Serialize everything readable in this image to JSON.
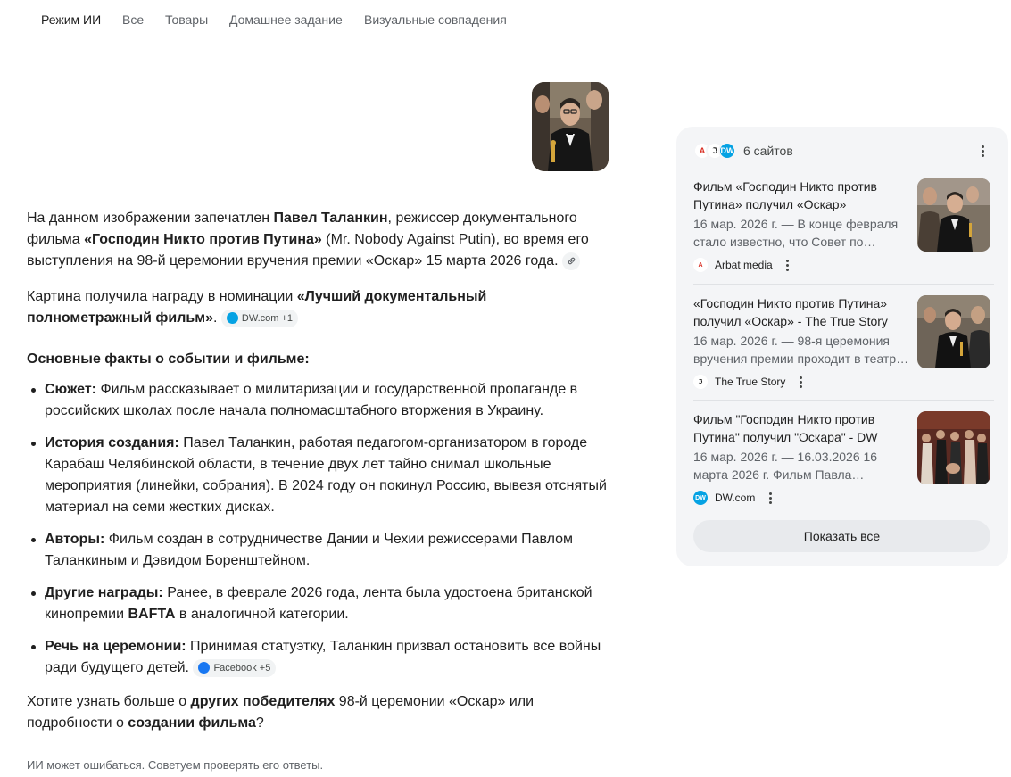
{
  "tabs": [
    {
      "label": "Режим ИИ",
      "active": true
    },
    {
      "label": "Все"
    },
    {
      "label": "Товары"
    },
    {
      "label": "Домашнее задание"
    },
    {
      "label": "Визуальные совпадения"
    }
  ],
  "answer": {
    "p1": {
      "t1": "На данном изображении запечатлен ",
      "b1": "Павел Таланкин",
      "t2": ", режиссер документального фильма ",
      "b2": "«Господин Никто против Путина»",
      "t3": " (Mr. Nobody Against Putin), во время его выступления на 98-й церемонии вручения премии «Оскар» 15 марта 2026 года."
    },
    "p2": {
      "t1": "Картина получила награду в номинации ",
      "b1": "«Лучший документальный полнометражный фильм»",
      "t2": ".",
      "chip": "DW.com +1"
    },
    "heading": "Основные факты о событии и фильме:",
    "facts": [
      {
        "label": "Сюжет:",
        "text": " Фильм рассказывает о милитаризации и государственной пропаганде в российских школах после начала полномасштабного вторжения в Украину."
      },
      {
        "label": "История создания:",
        "text": " Павел Таланкин, работая педагогом-организатором в городе Карабаш Челябинской области, в течение двух лет тайно снимал школьные мероприятия (линейки, собрания). В 2024 году он покинул Россию, вывезя отснятый материал на семи жестких дисках."
      },
      {
        "label": "Авторы:",
        "text": " Фильм создан в сотрудничестве Дании и Чехии режиссерами Павлом Таланкиным и Дэвидом Боренштейном."
      },
      {
        "label": "Другие награды:",
        "text": " Ранее, в феврале 2026 года, лента была удостоена британской кинопремии ",
        "bold2": "BAFTA",
        "text2": " в аналогичной категории."
      },
      {
        "label": "Речь на церемонии:",
        "text": " Принимая статуэтку, Таланкин призвал остановить все войны ради будущего детей.",
        "chip": "Facebook +5"
      }
    ],
    "followup": {
      "t1": "Хотите узнать больше о ",
      "b1": "других победителях",
      "t2": " 98-й церемонии «Оскар» или подробности о ",
      "b2": "создании фильма",
      "t3": "?"
    }
  },
  "disclaimer": "ИИ может ошибаться. Советуем проверять его ответы.",
  "sources": {
    "count_label": "6 сайтов",
    "cards": [
      {
        "title": "Фильм «Господин Никто против Путина» получил «Оскар»",
        "snippet": "16 мар. 2026 г. — В конце февраля стало известно, что Совет по…",
        "source": "Arbat media"
      },
      {
        "title": "«Господин Никто против Путина» получил «Оскар» - The True Story",
        "snippet": "16 мар. 2026 г. — 98-я церемония вручения премии проходит в театр…",
        "source": "The True Story"
      },
      {
        "title": "Фильм \"Господин Никто против Путина\" получил \"Оскара\" - DW",
        "snippet": "16 мар. 2026 г. — 16.03.2026 16 марта 2026 г. Фильм Павла…",
        "source": "DW.com"
      }
    ],
    "show_all": "Показать все"
  },
  "colors": {
    "arbat": "#d93025",
    "dw": "#05a2e3",
    "truestory": "#e8437a",
    "facebook": "#1877f2"
  }
}
